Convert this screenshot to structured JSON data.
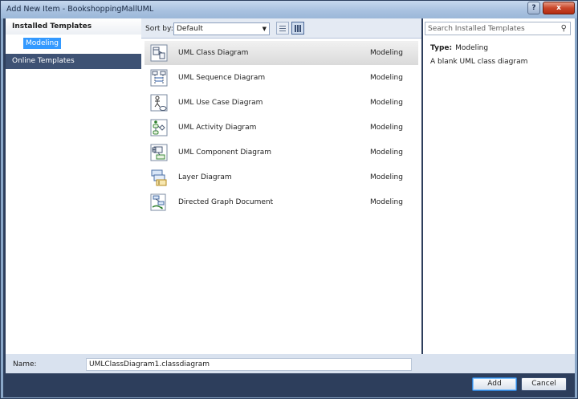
{
  "window": {
    "title": "Add New Item - BookshoppingMallUML"
  },
  "titlebar": {
    "help_glyph": "?",
    "close_glyph": "x"
  },
  "leftnav": {
    "installed_label": "Installed Templates",
    "modeling_label": "Modeling",
    "online_label": "Online Templates"
  },
  "toolbar": {
    "sort_label": "Sort by:",
    "sort_value": "Default",
    "sort_arrow": "▼"
  },
  "templates": [
    {
      "name": "UML Class Diagram",
      "category": "Modeling",
      "icon": "class-diagram-icon"
    },
    {
      "name": "UML Sequence Diagram",
      "category": "Modeling",
      "icon": "sequence-diagram-icon"
    },
    {
      "name": "UML Use Case Diagram",
      "category": "Modeling",
      "icon": "use-case-diagram-icon"
    },
    {
      "name": "UML Activity Diagram",
      "category": "Modeling",
      "icon": "activity-diagram-icon"
    },
    {
      "name": "UML Component Diagram",
      "category": "Modeling",
      "icon": "component-diagram-icon"
    },
    {
      "name": "Layer Diagram",
      "category": "Modeling",
      "icon": "layer-diagram-icon"
    },
    {
      "name": "Directed Graph Document",
      "category": "Modeling",
      "icon": "directed-graph-icon"
    }
  ],
  "selected_template_index": 0,
  "rightpanel": {
    "search_placeholder": "Search Installed Templates",
    "search_glyph": "⚲",
    "type_label": "Type:",
    "type_value": "Modeling",
    "description": "A blank UML class diagram"
  },
  "namerow": {
    "label": "Name:",
    "value": "UMLClassDiagram1.classdiagram"
  },
  "buttons": {
    "add": "Add",
    "cancel": "Cancel"
  },
  "colors": {
    "selection_blue": "#3399ff",
    "chrome_dark": "#2d3e5c",
    "online_bg": "#3e5274"
  }
}
